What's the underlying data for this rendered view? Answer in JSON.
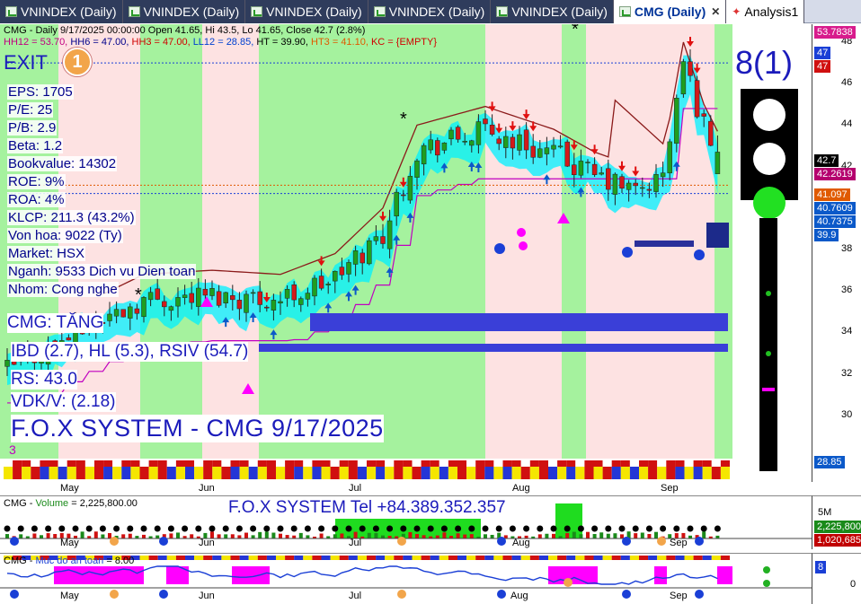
{
  "tabs": [
    {
      "label": "VNINDEX (Daily)",
      "active": false
    },
    {
      "label": "VNINDEX (Daily)",
      "active": false
    },
    {
      "label": "VNINDEX (Daily)",
      "active": false
    },
    {
      "label": "VNINDEX (Daily)",
      "active": false
    },
    {
      "label": "VNINDEX (Daily)",
      "active": false
    },
    {
      "label": "CMG (Daily)",
      "active": true
    },
    {
      "label": "Analysis1",
      "active": false
    }
  ],
  "main": {
    "header_line1": "CMG - Daily 9/17/2025 00:00:00 Open 41.65, Hi 43.5, Lo 41.65, Close 42.7 (2.8%)",
    "header_line2": {
      "hh12": "HH12 = 53.70,",
      "hh6": "HH6 = 47.00,",
      "hh3": "HH3 = 47.00,",
      "ll12": "LL12 = 28.85,",
      "ht": "HT = 39.90,",
      "ht3": "HT3 = 41.10,",
      "kc": "KC = {EMPTY}"
    },
    "exit_label": "EXIT",
    "exit_count": "1",
    "signal_label": "8(1)",
    "fundamentals": [
      "EPS: 1705",
      "P/E: 25",
      "P/B: 2.9",
      "Beta: 1.2",
      "Bookvalue: 14302",
      "ROE: 9%",
      "ROA: 4%",
      "KLCP: 211.3 (43.2%)",
      "Von hoa: 9022 (Ty)",
      "Market: HSX",
      "Nganh: 9533 Dich vu Dien toan",
      "Nhom: Cong nghe"
    ],
    "trend_label": "CMG: TĂNG",
    "ibd_line": "IBD (2.7), HL (5.3), RSIV (54.7)",
    "rs_line": "RS: 43.0",
    "vdk_line": "VDK/V:  (2.18)",
    "system_title": "F.O.X SYSTEM - CMG 9/17/2025",
    "small_marker": "3",
    "months": [
      "May",
      "Jun",
      "Jul",
      "Aug",
      "Sep"
    ],
    "y_ticks": [
      "48",
      "46",
      "44",
      "42",
      "40",
      "38",
      "36",
      "34",
      "32",
      "30"
    ],
    "price_tags": [
      {
        "label": "53.7838",
        "color": "#d81b8c"
      },
      {
        "label": "47",
        "color": "#1a3fd6"
      },
      {
        "label": "47",
        "color": "#d01010"
      },
      {
        "label": "42.7",
        "color": "#000000"
      },
      {
        "label": "42.2619",
        "color": "#b5006e"
      },
      {
        "label": "41.097",
        "color": "#e05a00"
      },
      {
        "label": "40.7609",
        "color": "#0b59c9"
      },
      {
        "label": "40.7375",
        "color": "#0b59c9"
      },
      {
        "label": "39.9",
        "color": "#0b59c9"
      },
      {
        "label": "28.85",
        "color": "#0b59c9"
      }
    ],
    "last_close": 42.7,
    "period_start": "2025-04-21",
    "period_end": "2025-09-17"
  },
  "volume": {
    "header_name": "CMG",
    "header_label": "Volume",
    "header_value": "= 2,225,800.00",
    "contact": "F.O.X SYSTEM Tel +84.389.352.357",
    "ticks": [
      "5M"
    ],
    "tags": [
      {
        "label": "2,225,800",
        "color": "#1a8a1a"
      },
      {
        "label": "1,020,685",
        "color": "#c00000"
      }
    ]
  },
  "indicator": {
    "header_name": "CMG",
    "header_label": "Muc do an toan",
    "header_value": "= 8.00",
    "ticks": [
      "0"
    ],
    "tag": "8"
  },
  "colors": {
    "up": "#1f9e1f",
    "down": "#d21a1a",
    "buy_zone": "#a5f29e",
    "sell_zone": "#fde2e2",
    "cyan_band": "#00f0ff",
    "ribbon_blue": "#3a3fd8",
    "magenta": "#ff00ff"
  }
}
